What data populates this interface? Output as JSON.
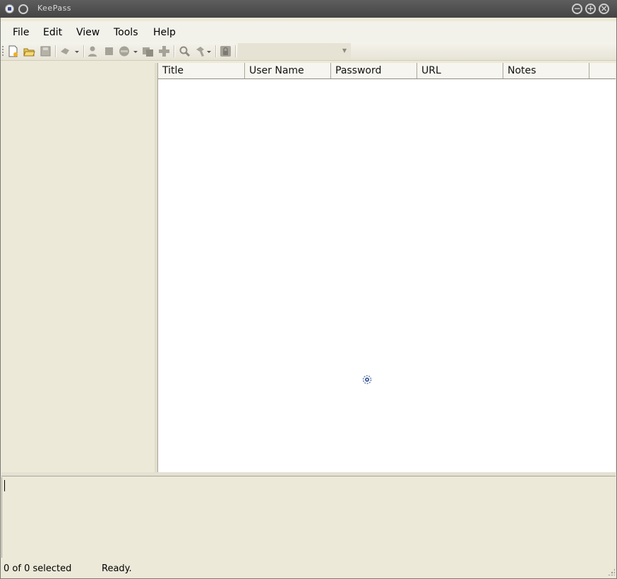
{
  "window": {
    "title": "KeePass"
  },
  "menu": {
    "items": [
      {
        "label": "File"
      },
      {
        "label": "Edit"
      },
      {
        "label": "View"
      },
      {
        "label": "Tools"
      },
      {
        "label": "Help"
      }
    ]
  },
  "toolbar": {
    "buttons": [
      {
        "icon": "new-database-icon"
      },
      {
        "icon": "open-database-icon"
      },
      {
        "icon": "save-database-icon"
      },
      {
        "icon": "sync-dropdown-icon"
      },
      {
        "icon": "add-entry-icon"
      },
      {
        "icon": "copy-username-icon"
      },
      {
        "icon": "copy-password-dropdown-icon"
      },
      {
        "icon": "copy-url-icon"
      },
      {
        "icon": "autotype-icon"
      },
      {
        "icon": "find-icon"
      },
      {
        "icon": "tools-dropdown-icon"
      },
      {
        "icon": "lock-workspace-icon"
      }
    ],
    "quick_search_value": ""
  },
  "entry_list": {
    "columns": [
      "Title",
      "User Name",
      "Password",
      "URL",
      "Notes"
    ],
    "rows": []
  },
  "status": {
    "selected": "0 of 0 selected",
    "message": "Ready."
  },
  "colors": {
    "window_bg": "#ece9d8",
    "titlebar": "#4a4a4a",
    "list_bg": "#ffffff"
  }
}
